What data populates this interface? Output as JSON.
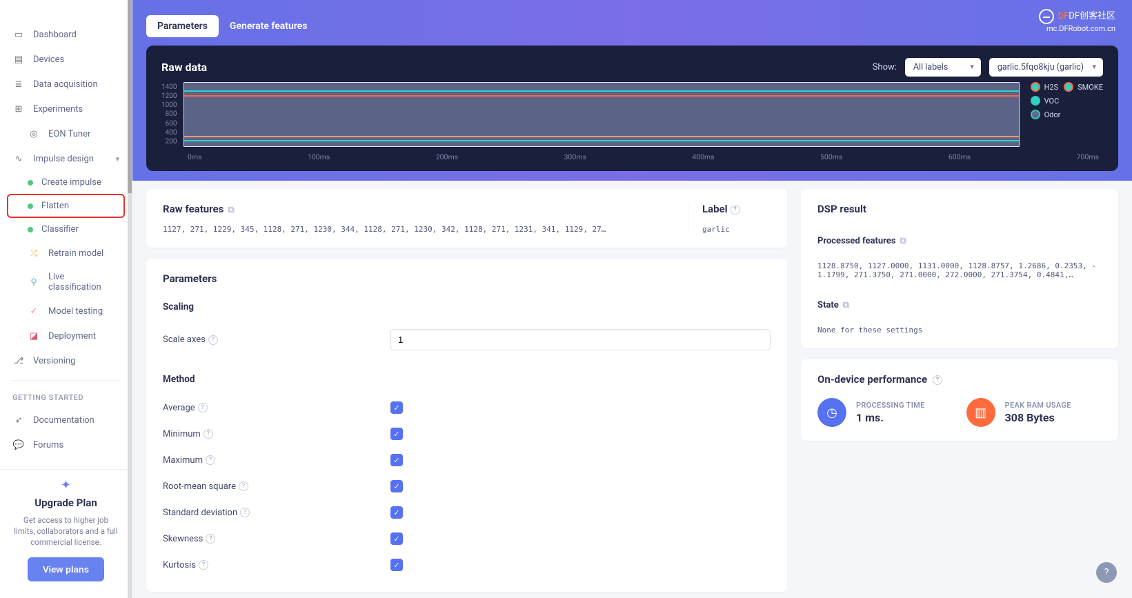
{
  "sidebar": {
    "items": [
      {
        "label": "Dashboard"
      },
      {
        "label": "Devices"
      },
      {
        "label": "Data acquisition"
      },
      {
        "label": "Experiments"
      },
      {
        "label": "EON Tuner"
      },
      {
        "label": "Impulse design"
      },
      {
        "label": "Create impulse"
      },
      {
        "label": "Flatten"
      },
      {
        "label": "Classifier"
      },
      {
        "label": "Retrain model"
      },
      {
        "label": "Live classification"
      },
      {
        "label": "Model testing"
      },
      {
        "label": "Deployment"
      },
      {
        "label": "Versioning"
      }
    ],
    "getting_started_header": "GETTING STARTED",
    "docs": "Documentation",
    "forums": "Forums",
    "upgrade_title": "Upgrade Plan",
    "upgrade_text": "Get access to higher job limits, collaborators and a full commercial license.",
    "view_plans": "View plans"
  },
  "tabs": {
    "parameters": "Parameters",
    "generate": "Generate features"
  },
  "watermark": {
    "line1": "DF创客社区",
    "line2": "mc.DFRobot.com.cn"
  },
  "raw": {
    "title": "Raw data",
    "show_label": "Show:",
    "show_value": "All labels",
    "sample_value": "garlic.5fqo8kju (garlic)"
  },
  "chart_data": {
    "type": "line",
    "title": "Raw data",
    "x_unit": "ms",
    "x_ticks": [
      "0ms",
      "100ms",
      "200ms",
      "300ms",
      "400ms",
      "500ms",
      "600ms",
      "700ms"
    ],
    "y_ticks": [
      "1400",
      "1200",
      "1000",
      "800",
      "600",
      "400",
      "200"
    ],
    "xlim": [
      0,
      750
    ],
    "ylim": [
      200,
      1400
    ],
    "series": [
      {
        "name": "H2S",
        "color_border": "#ff6848",
        "color_fill": "#2fd2c4",
        "approx_value": 1128
      },
      {
        "name": "SMOKE",
        "color_border": "#ff6848",
        "color_fill": "#2fd2c4",
        "approx_value": 1230
      },
      {
        "name": "VOC",
        "color_border": "#32c9b2",
        "color_fill": "#2fd2c4",
        "approx_value": 271
      },
      {
        "name": "Odor",
        "color_border": "#32c9b2",
        "color_fill": "#606a8e",
        "approx_value": 341
      }
    ],
    "note": "All series are flat (constant) across the time axis; values read from Raw features."
  },
  "features": {
    "header": "Raw features",
    "data": "1127, 271, 1229, 345, 1128, 271, 1230, 344, 1128, 271, 1230, 342, 1128, 271, 1231, 341, 1129, 27…",
    "label_header": "Label",
    "label_value": "garlic"
  },
  "params": {
    "header": "Parameters",
    "scaling_header": "Scaling",
    "scale_axes_label": "Scale axes",
    "scale_axes_value": "1",
    "method_header": "Method",
    "methods": [
      {
        "label": "Average",
        "checked": true
      },
      {
        "label": "Minimum",
        "checked": true
      },
      {
        "label": "Maximum",
        "checked": true
      },
      {
        "label": "Root-mean square",
        "checked": true
      },
      {
        "label": "Standard deviation",
        "checked": true
      },
      {
        "label": "Skewness",
        "checked": true
      },
      {
        "label": "Kurtosis",
        "checked": true
      }
    ]
  },
  "dsp": {
    "header": "DSP result",
    "pf_header": "Processed features",
    "pf_data": "1128.8750, 1127.0000, 1131.0000, 1128.8757, 1.2686, 0.2353, -1.1799, 271.3750, 271.0000, 272.0000, 271.3754, 0.4841,…",
    "state_header": "State",
    "state_value": "None for these settings"
  },
  "perf": {
    "header": "On-device performance",
    "time_cap": "PROCESSING TIME",
    "time_val": "1 ms.",
    "ram_cap": "PEAK RAM USAGE",
    "ram_val": "308 Bytes"
  }
}
